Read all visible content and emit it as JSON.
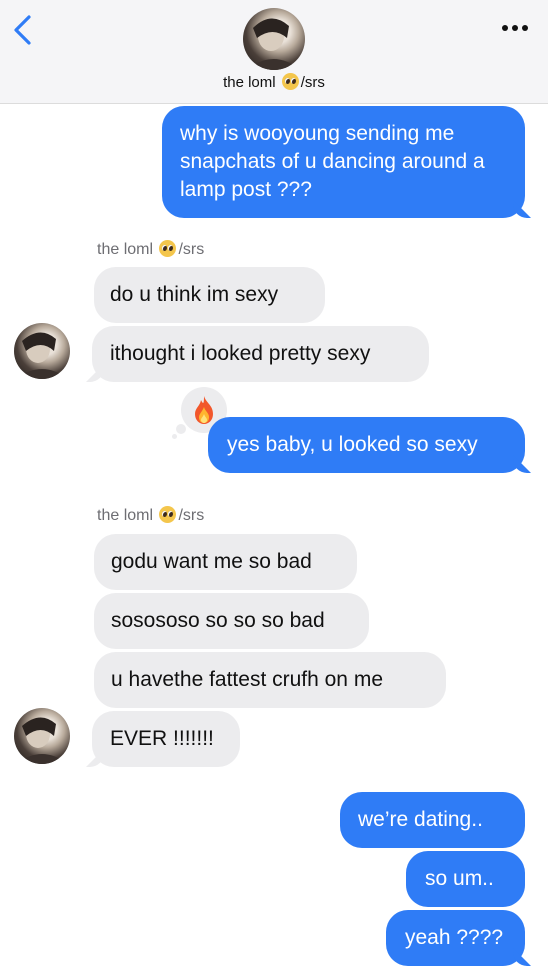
{
  "header": {
    "contact_name": "the loml",
    "contact_suffix": "/srs"
  },
  "messages": {
    "m1": "why is wooyoung sending me snapchats of u dancing around a lamp post ???",
    "label1_name": "the loml",
    "label1_suffix": "/srs",
    "m2": "do u think im sexy",
    "m3": "ithought i looked pretty sexy",
    "m4": "yes baby, u looked so sexy",
    "label2_name": "the loml",
    "label2_suffix": "/srs",
    "m5": "godu want me so bad",
    "m6": "sosososo so so so bad",
    "m7": "u havethe fattest crufh on me",
    "m8": "EVER !!!!!!!",
    "m9": "we’re dating..",
    "m10": "so um..",
    "m11": "yeah ????"
  },
  "icons": {
    "back": "chevron-left-icon",
    "more": "more-dots-icon",
    "reaction": "fire-emoji"
  },
  "colors": {
    "sent_bubble": "#2f7cf6",
    "received_bubble": "#ececee",
    "back_accent": "#2f7cf6"
  }
}
